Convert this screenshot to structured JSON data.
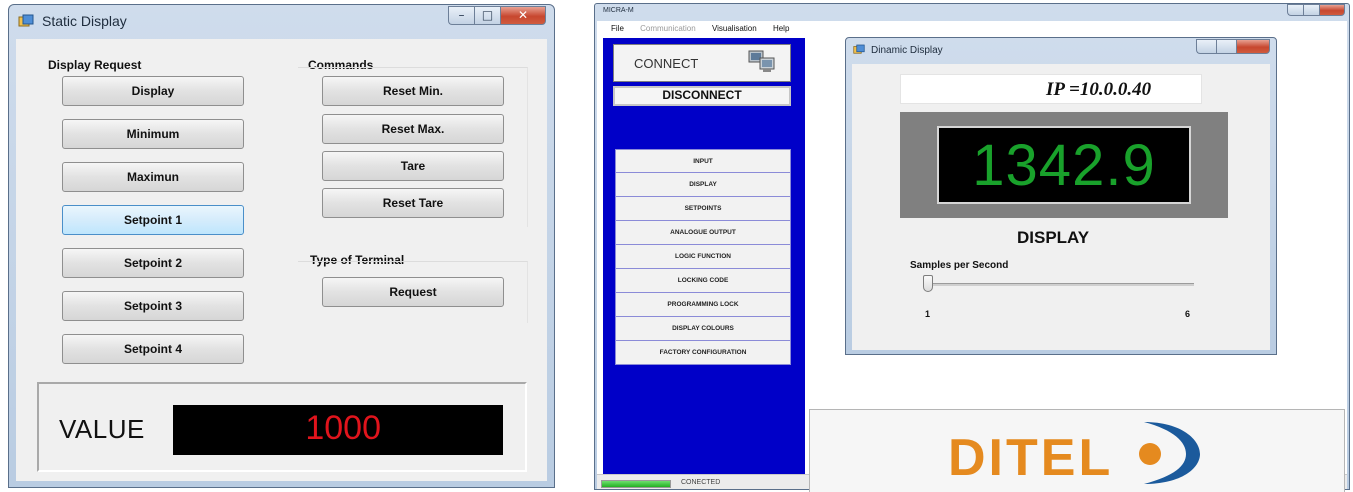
{
  "static_window": {
    "title": "Static Display",
    "display_request_label": "Display Request",
    "commands_label": "Commands",
    "type_of_terminal_label": "Type of Terminal",
    "display_buttons": [
      "Display",
      "Minimum",
      "Maximun",
      "Setpoint 1",
      "Setpoint 2",
      "Setpoint 3",
      "Setpoint 4"
    ],
    "command_buttons": [
      "Reset Min.",
      "Reset Max.",
      "Tare",
      "Reset Tare"
    ],
    "request_button": "Request",
    "value_label": "VALUE",
    "value": "1000",
    "colors": {
      "value": "#e0141c",
      "value_bg": "#000000"
    }
  },
  "main_window": {
    "title": "MICRA-M",
    "menu": [
      "File",
      "Communication",
      "Visualisation",
      "Help"
    ],
    "connect_label": "CONNECT",
    "connect_icon": "computer-network-icon",
    "disconnect_label": "DISCONNECT",
    "menu_items": [
      "INPUT",
      "DISPLAY",
      "SETPOINTS",
      "ANALOGUE OUTPUT",
      "LOGIC FUNCTION",
      "LOCKING CODE",
      "PROGRAMMING LOCK",
      "DISPLAY COLOURS",
      "FACTORY CONFIGURATION"
    ],
    "status_text": "CONECTED",
    "progress_fraction": 1.0,
    "brand": "DITEL",
    "colors": {
      "panel": "#0000c8",
      "brand_orange": "#e58a1f",
      "brand_blue": "#1b5a9c"
    }
  },
  "dynamic_window": {
    "title": "Dinamic Display",
    "ip_text": "IP =10.0.0.40",
    "display_value": "1342.9",
    "display_label": "DISPLAY",
    "samples_label": "Samples per Second",
    "slider_min": "1",
    "slider_max": "6",
    "slider_value": 1,
    "colors": {
      "digits": "#19a12b"
    }
  }
}
